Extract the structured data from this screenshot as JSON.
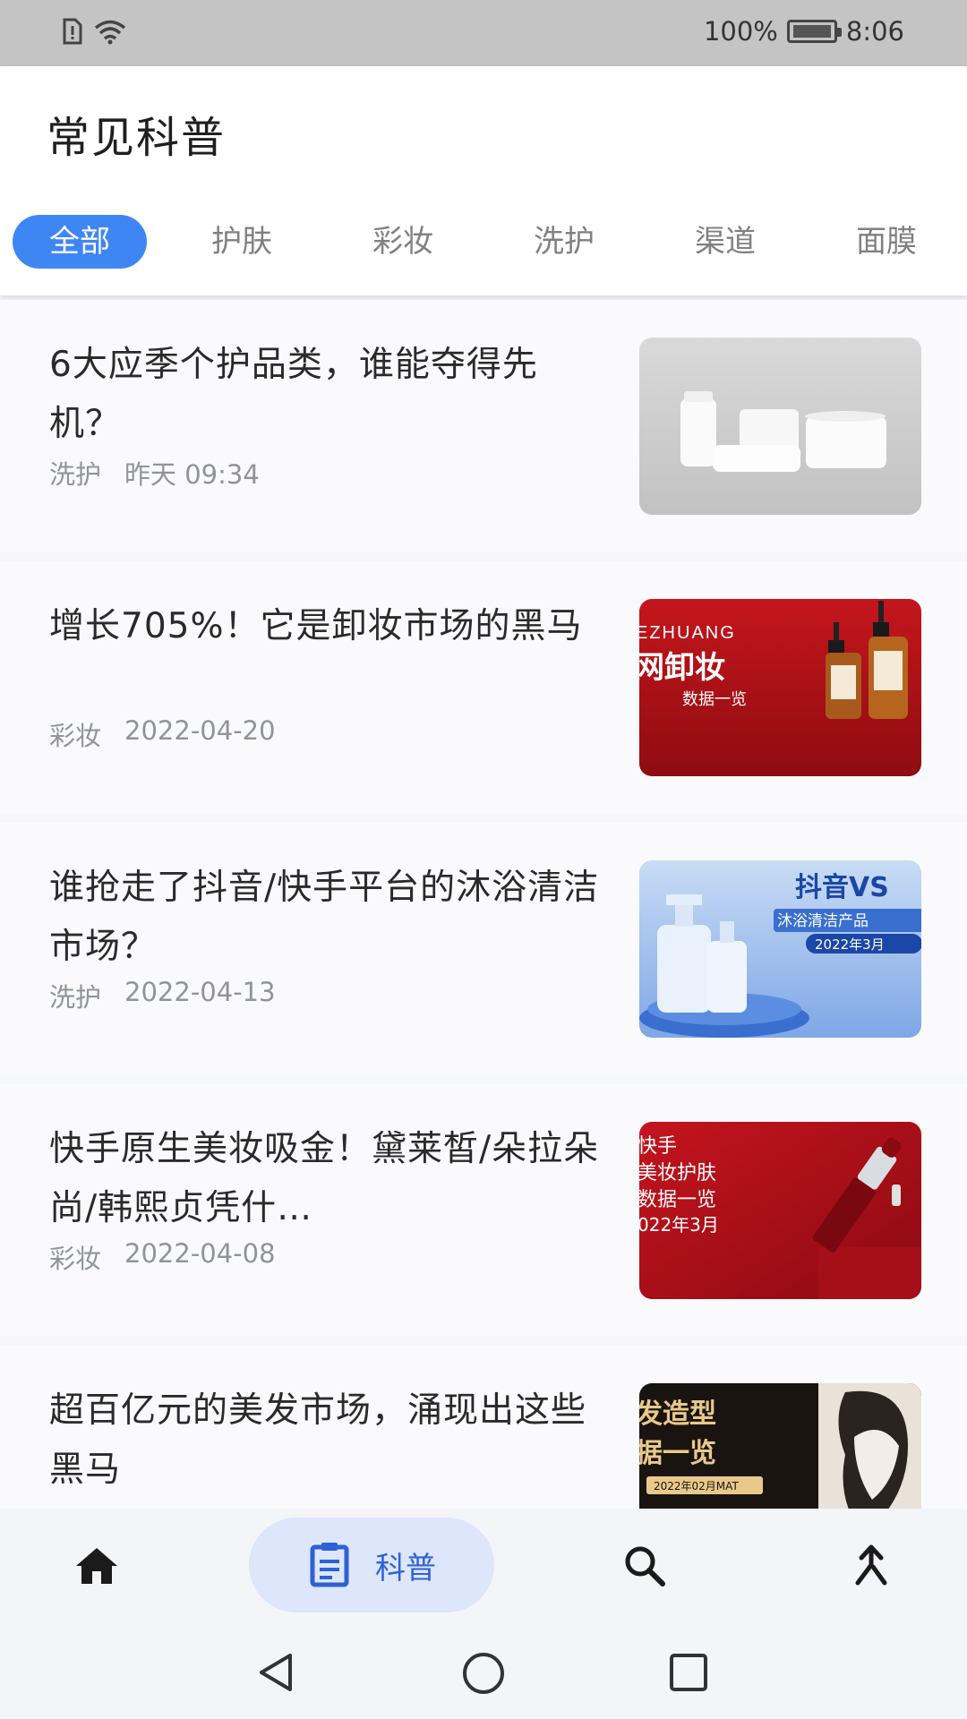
{
  "status_bar": {
    "battery_percent": "100%",
    "time": "8:06"
  },
  "header": {
    "title": "常见科普",
    "tabs": [
      {
        "label": "全部",
        "active": true
      },
      {
        "label": "护肤",
        "active": false
      },
      {
        "label": "彩妆",
        "active": false
      },
      {
        "label": "洗护",
        "active": false
      },
      {
        "label": "渠道",
        "active": false
      },
      {
        "label": "面膜",
        "active": false
      }
    ]
  },
  "articles": [
    {
      "title": "6大应季个护品类，谁能夺得先机？",
      "category": "洗护",
      "date": "昨天 09:34"
    },
    {
      "title": "增长705%！它是卸妆市场的黑马",
      "category": "彩妆",
      "date": "2022-04-20",
      "thumb_text": {
        "line1": "EZHUANG",
        "line2": "网卸妆",
        "line3": "数据一览"
      }
    },
    {
      "title": "谁抢走了抖音/快手平台的沐浴清洁市场？",
      "category": "洗护",
      "date": "2022-04-13",
      "thumb_text": {
        "line1": "抖音VS",
        "line2": "沐浴清洁产品",
        "line3": "2022年3月"
      }
    },
    {
      "title": "快手原生美妆吸金！黛莱皙/朵拉朵尚/韩熙贞凭什…",
      "category": "彩妆",
      "date": "2022-04-08",
      "thumb_text": {
        "line1": "快手",
        "line2": "美妆护肤",
        "line3": "数据一览",
        "line4": "022年3月"
      }
    },
    {
      "title": "超百亿元的美发市场，涌现出这些黑马",
      "thumb_text": {
        "line1": "发造型",
        "line2": "据一览",
        "line3": "2022年02月MAT"
      }
    }
  ],
  "bottom_nav": {
    "active_label": "科普",
    "items": [
      "home-icon",
      "article-icon",
      "search-icon",
      "merge-icon"
    ]
  },
  "colors": {
    "accent": "#3f86f5",
    "pill": "#dde6fb",
    "pill_text": "#2e61d6"
  }
}
